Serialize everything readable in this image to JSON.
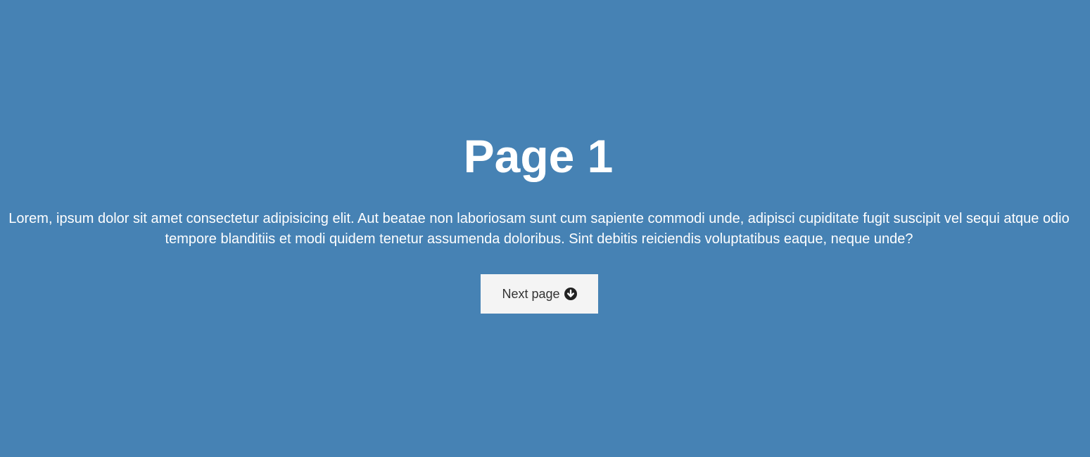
{
  "page": {
    "title": "Page 1",
    "paragraph": "Lorem, ipsum dolor sit amet consectetur adipisicing elit. Aut beatae non laboriosam sunt cum sapiente commodi unde, adipisci cupiditate fugit suscipit vel sequi atque odio tempore blanditiis et modi quidem tenetur assumenda doloribus. Sint debitis reiciendis voluptatibus eaque, neque unde?"
  },
  "next_button": {
    "label": "Next page",
    "icon": "arrow-circle-down-icon"
  },
  "colors": {
    "background": "#4682b4",
    "text": "#ffffff",
    "button_background": "#f4f4f4",
    "button_text": "#333333"
  }
}
